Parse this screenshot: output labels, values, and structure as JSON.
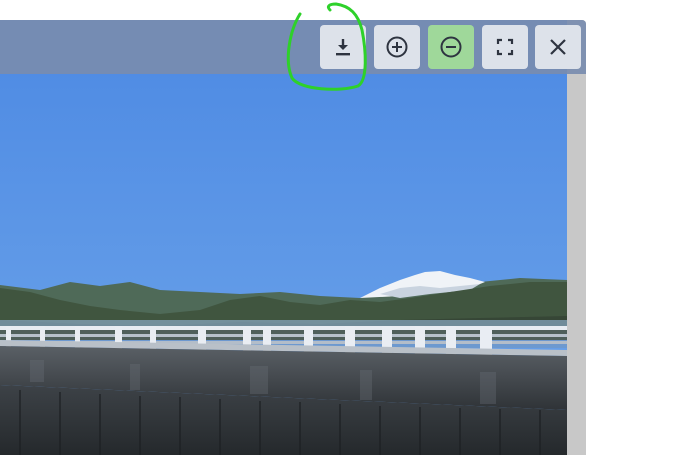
{
  "viewer": {
    "toolbar": {
      "buttons": [
        {
          "id": "download",
          "icon": "download-icon",
          "active": false
        },
        {
          "id": "zoom-in",
          "icon": "zoom-in-icon",
          "active": false
        },
        {
          "id": "zoom-out",
          "icon": "zoom-out-icon",
          "active": true
        },
        {
          "id": "fullscreen",
          "icon": "fullscreen-icon",
          "active": false
        },
        {
          "id": "close",
          "icon": "close-icon",
          "active": false
        }
      ]
    },
    "image": {
      "subject": "landscape-photo"
    }
  },
  "colors": {
    "toolbar_bg": "#788caf",
    "button_bg": "#dde2ea",
    "button_active_bg": "#9fd89a",
    "icon_color": "#2e3440",
    "annotation_stroke": "#2ed12a",
    "sky_top": "#4e8de6",
    "sky_bottom": "#6aa2e8"
  }
}
